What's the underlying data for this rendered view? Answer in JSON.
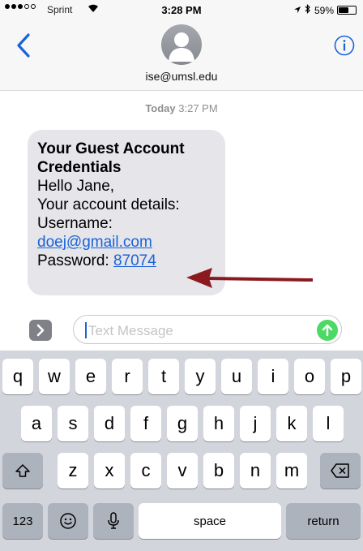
{
  "status_bar": {
    "carrier": "Sprint",
    "time": "3:28 PM",
    "battery": "59%",
    "battery_level": 0.59,
    "signal_bars": 3,
    "signal_total": 5,
    "icons": [
      "wifi-icon",
      "location-icon",
      "bluetooth-icon",
      "battery-icon"
    ]
  },
  "header": {
    "contact": "ise@umsl.edu",
    "back_icon": "chevron-left-icon",
    "info_icon": "info-icon"
  },
  "thread": {
    "timestamp_day": "Today",
    "timestamp_time": "3:27 PM",
    "message": {
      "title_line1": "Your Guest Account",
      "title_line2": "Credentials",
      "greeting": "Hello Jane,",
      "details": "Your account details:",
      "username_label": "Username:",
      "username": "doej@gmail.com",
      "password_label": "Password:",
      "password": "87074"
    }
  },
  "input": {
    "placeholder": "Text Message",
    "apps_icon": "app-store-icon",
    "send_icon": "arrow-up-icon"
  },
  "keyboard": {
    "row1": [
      "q",
      "w",
      "e",
      "r",
      "t",
      "y",
      "u",
      "i",
      "o",
      "p"
    ],
    "row2": [
      "a",
      "s",
      "d",
      "f",
      "g",
      "h",
      "j",
      "k",
      "l"
    ],
    "row3": [
      "z",
      "x",
      "c",
      "v",
      "b",
      "n",
      "m"
    ],
    "numbers": "123",
    "space": "space",
    "return": "return"
  },
  "colors": {
    "accent": "#1a63d8",
    "send": "#4cd964",
    "bubble": "#e5e5ea",
    "arrow": "#8b1a1f"
  }
}
